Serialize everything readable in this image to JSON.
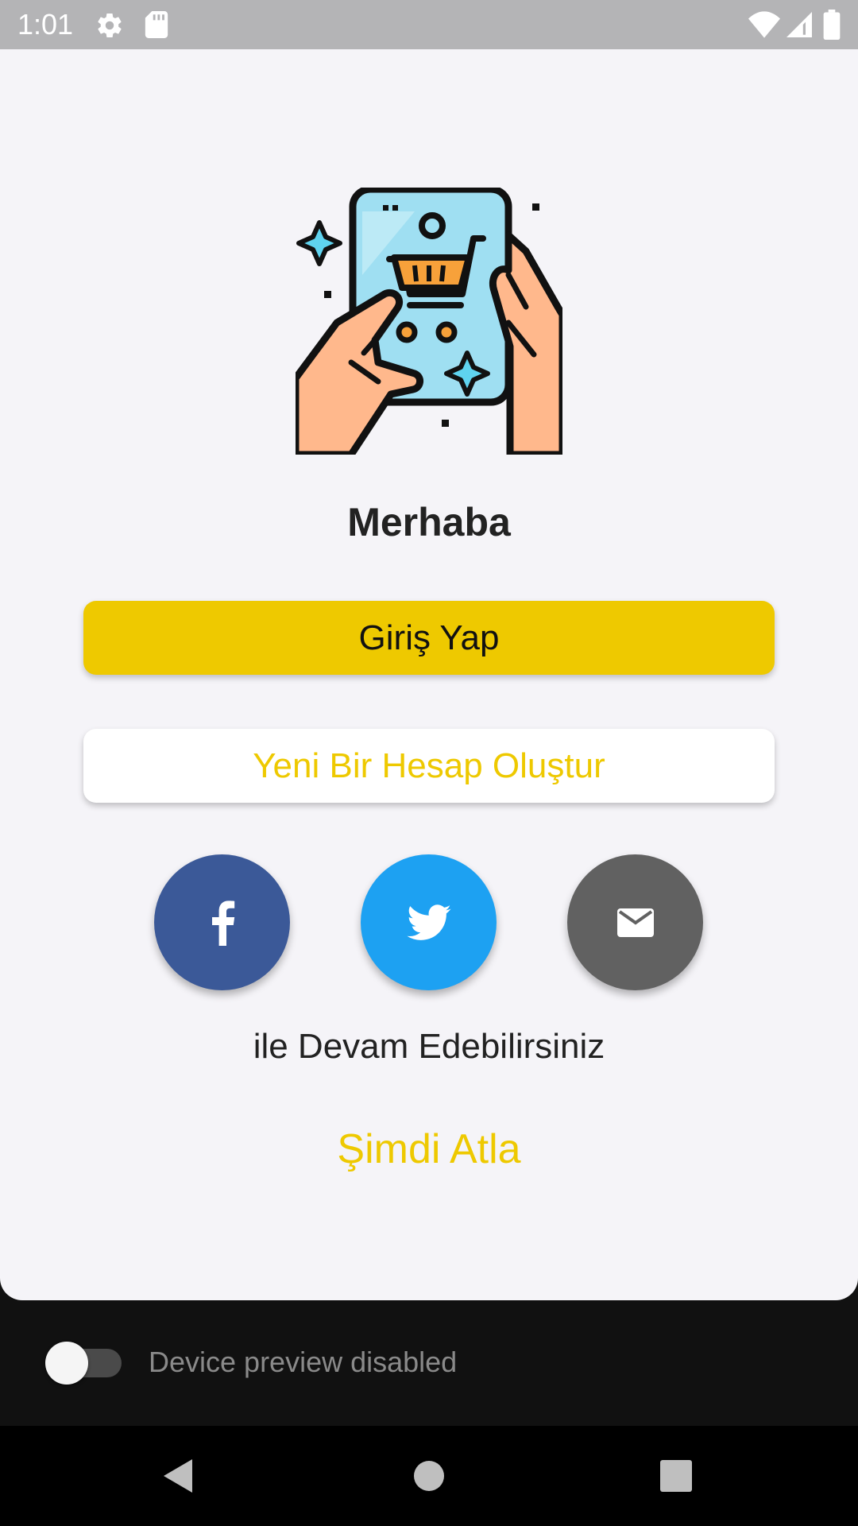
{
  "status_bar": {
    "time": "1:01",
    "icons": [
      "gear-icon",
      "sd-card-icon",
      "wifi-icon",
      "signal-icon",
      "battery-icon"
    ]
  },
  "hero": {
    "icon": "phone-shopping-cart-illustration"
  },
  "greeting": "Merhaba",
  "login_button": "Giriş Yap",
  "register_button": "Yeni Bir Hesap Oluştur",
  "social": {
    "facebook": {
      "icon": "facebook-icon",
      "color": "#3b5998"
    },
    "twitter": {
      "icon": "twitter-icon",
      "color": "#1da1f2"
    },
    "email": {
      "icon": "mail-icon",
      "color": "#616161"
    }
  },
  "continue_text": "ile Devam Edebilirsiniz",
  "skip_link": "Şimdi Atla",
  "device_preview": {
    "label": "Device preview disabled",
    "enabled": false
  },
  "nav_bar": {
    "icons": [
      "back-icon",
      "home-icon",
      "recents-icon"
    ]
  },
  "colors": {
    "accent": "#eec900",
    "background": "#f5f4f8",
    "text": "#222222"
  }
}
